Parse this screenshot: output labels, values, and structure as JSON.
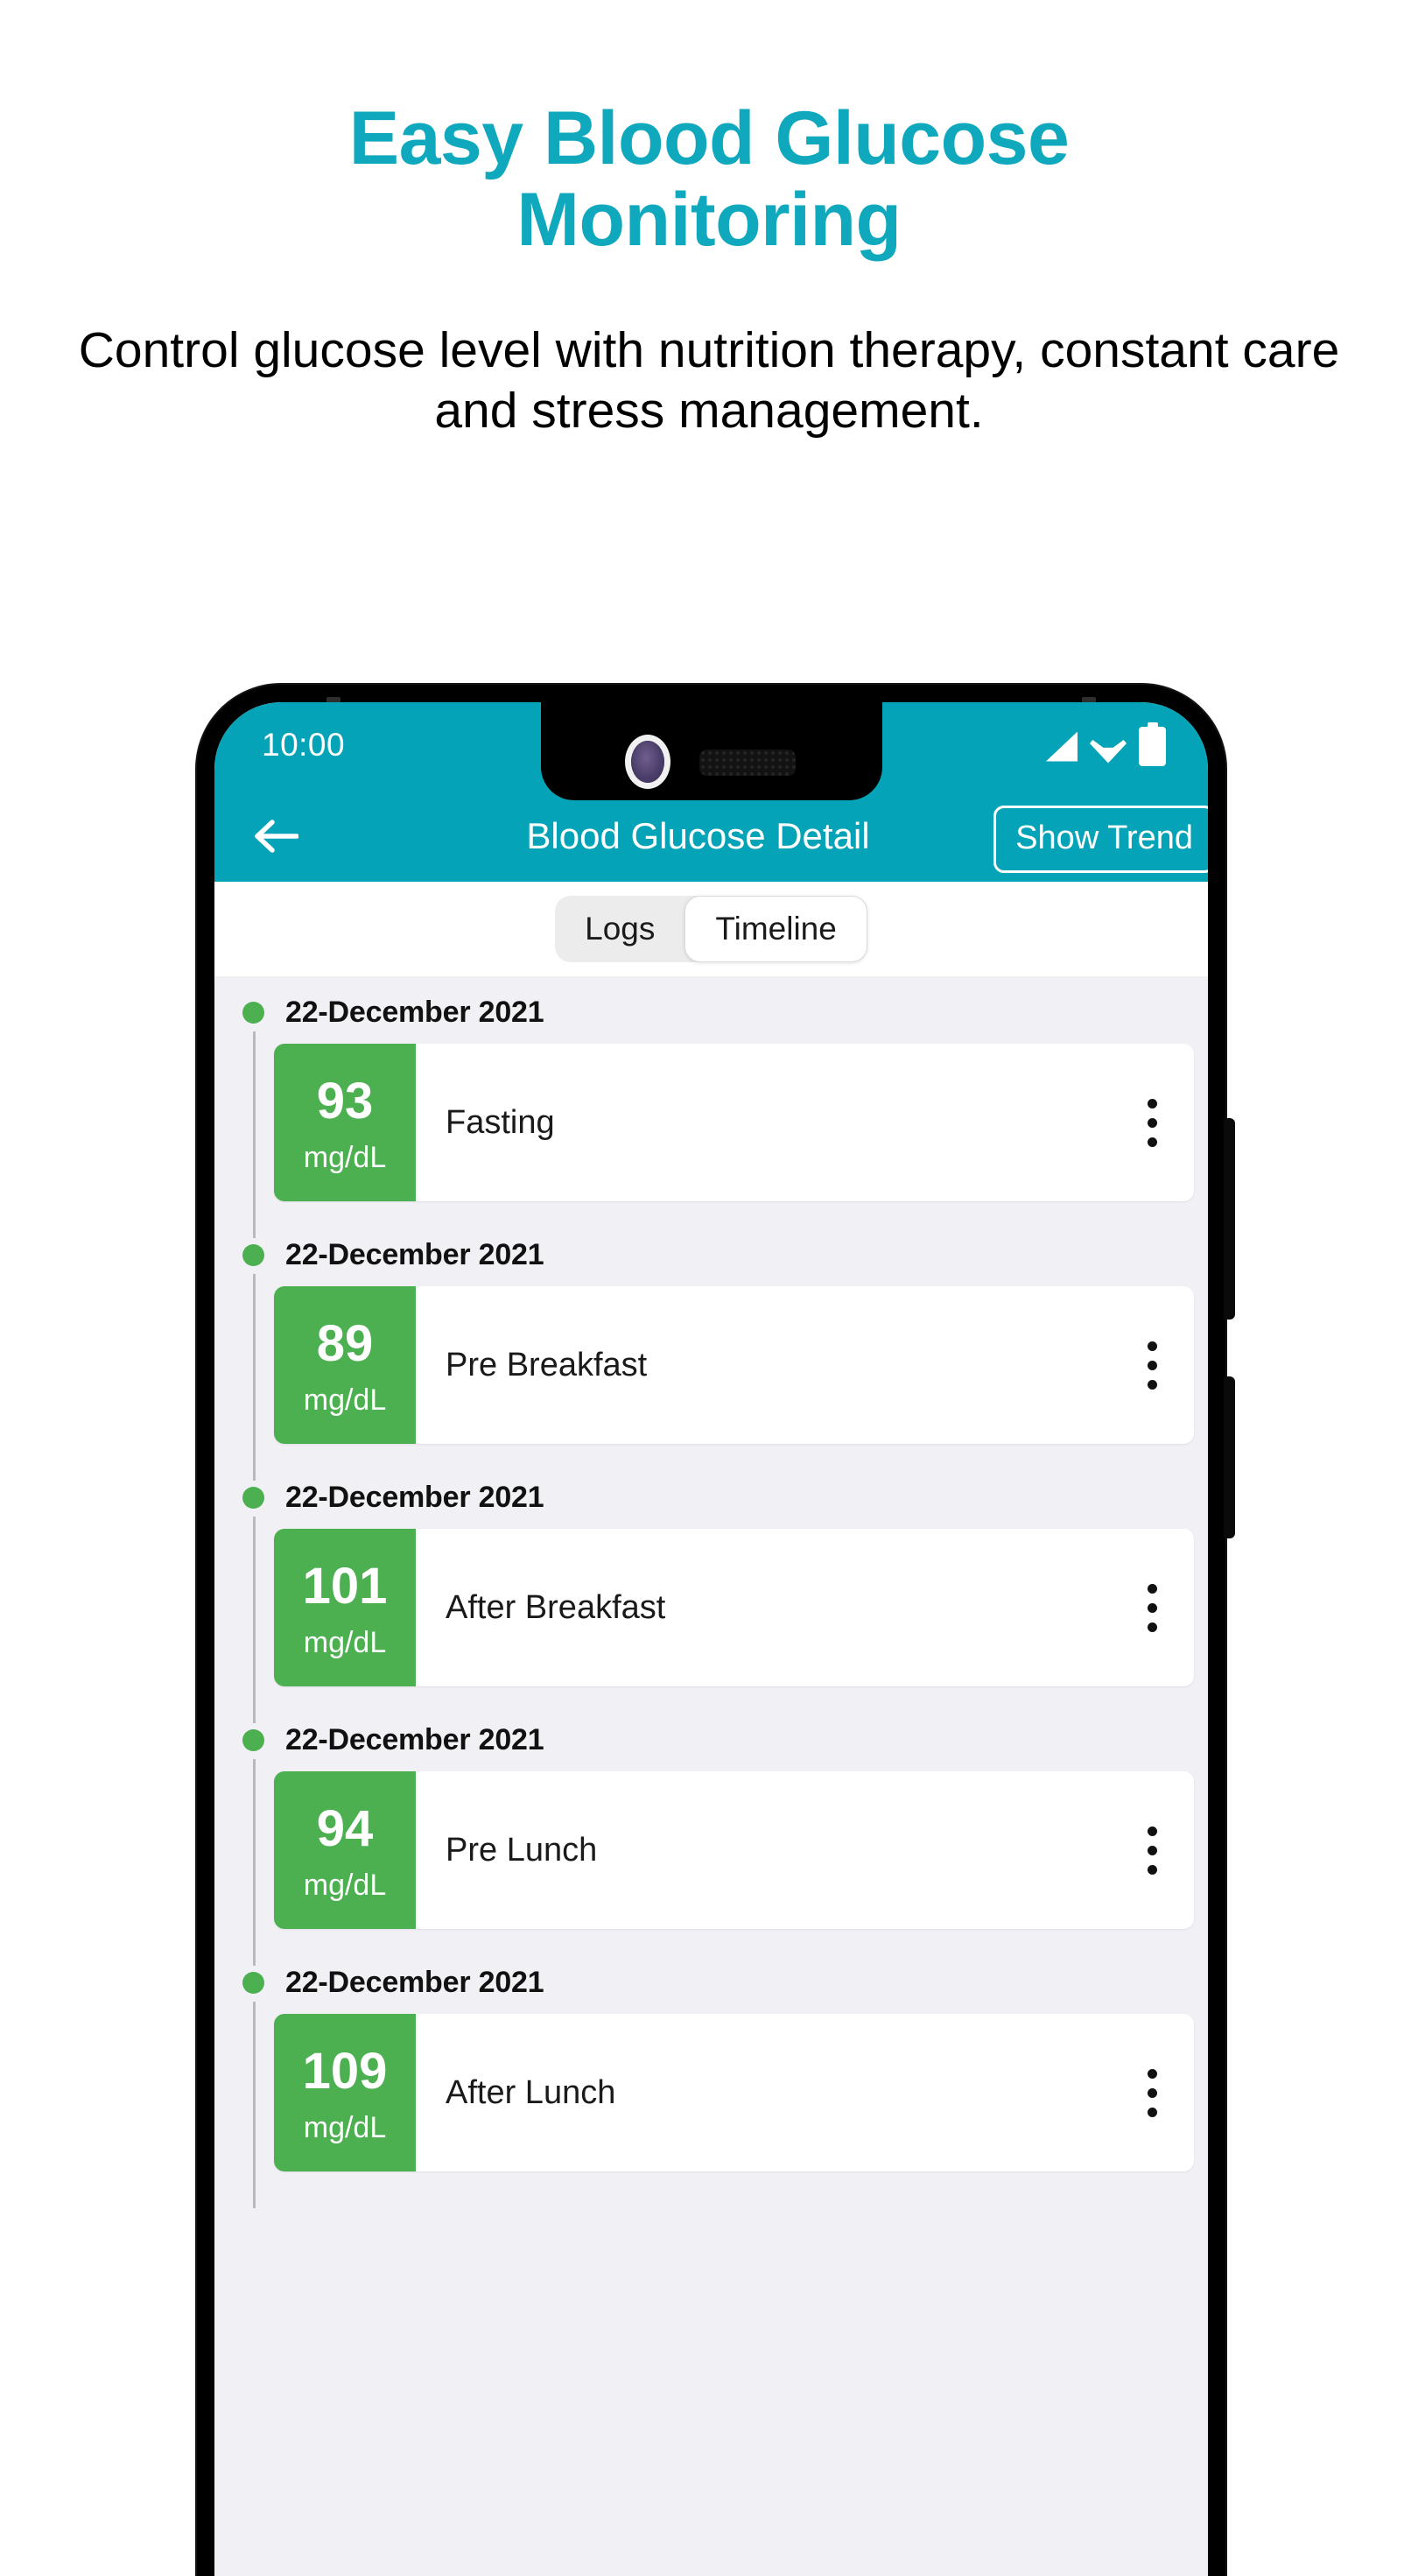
{
  "promo": {
    "headline": "Easy Blood Glucose Monitoring",
    "subtitle": "Control glucose level with nutrition therapy, constant care and stress management."
  },
  "colors": {
    "teal": "#05A3B7",
    "headline_teal": "#0FA8BD",
    "green": "#4CAF50",
    "list_background": "#F0F0F5",
    "card_background": "#FFFFFF"
  },
  "phone": {
    "status_bar": {
      "time": "10:00",
      "icons": [
        "signal-icon",
        "wifi-icon",
        "battery-icon"
      ]
    },
    "app_bar": {
      "back_icon": "arrow-left-icon",
      "title": "Blood Glucose Detail",
      "action_label": "Show Trend"
    },
    "tabs": {
      "items": [
        {
          "label": "Logs",
          "active": false
        },
        {
          "label": "Timeline",
          "active": true
        }
      ]
    },
    "timeline": {
      "entries": [
        {
          "date": "22-December 2021",
          "value": "93",
          "unit": "mg/dL",
          "label": "Fasting",
          "status_color": "#4CAF50",
          "menu_icon": "more-vertical-icon"
        },
        {
          "date": "22-December 2021",
          "value": "89",
          "unit": "mg/dL",
          "label": "Pre Breakfast",
          "status_color": "#4CAF50",
          "menu_icon": "more-vertical-icon"
        },
        {
          "date": "22-December 2021",
          "value": "101",
          "unit": "mg/dL",
          "label": "After Breakfast",
          "status_color": "#4CAF50",
          "menu_icon": "more-vertical-icon"
        },
        {
          "date": "22-December 2021",
          "value": "94",
          "unit": "mg/dL",
          "label": "Pre Lunch",
          "status_color": "#4CAF50",
          "menu_icon": "more-vertical-icon"
        },
        {
          "date": "22-December 2021",
          "value": "109",
          "unit": "mg/dL",
          "label": "After Lunch",
          "status_color": "#4CAF50",
          "menu_icon": "more-vertical-icon"
        }
      ]
    }
  }
}
